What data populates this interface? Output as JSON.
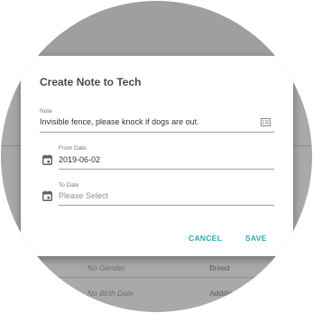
{
  "background": {
    "row1": {
      "left": "No Gender",
      "right": "Breed"
    },
    "row2": {
      "left": "No Birth Date",
      "right": "Additio"
    }
  },
  "dialog": {
    "title": "Create Note to Tech",
    "note": {
      "label": "Note",
      "value": "Invisible fence, please knock if dogs are out.",
      "icon": "notes-icon"
    },
    "from_date": {
      "label": "From Date",
      "value": "2019-06-02",
      "icon": "calendar-icon"
    },
    "to_date": {
      "label": "To Date",
      "placeholder": "Please Select",
      "icon": "calendar-icon"
    },
    "actions": {
      "cancel": "CANCEL",
      "save": "SAVE"
    }
  },
  "colors": {
    "accent": "#2aa7b5",
    "scrim": "#a9a9a9"
  }
}
